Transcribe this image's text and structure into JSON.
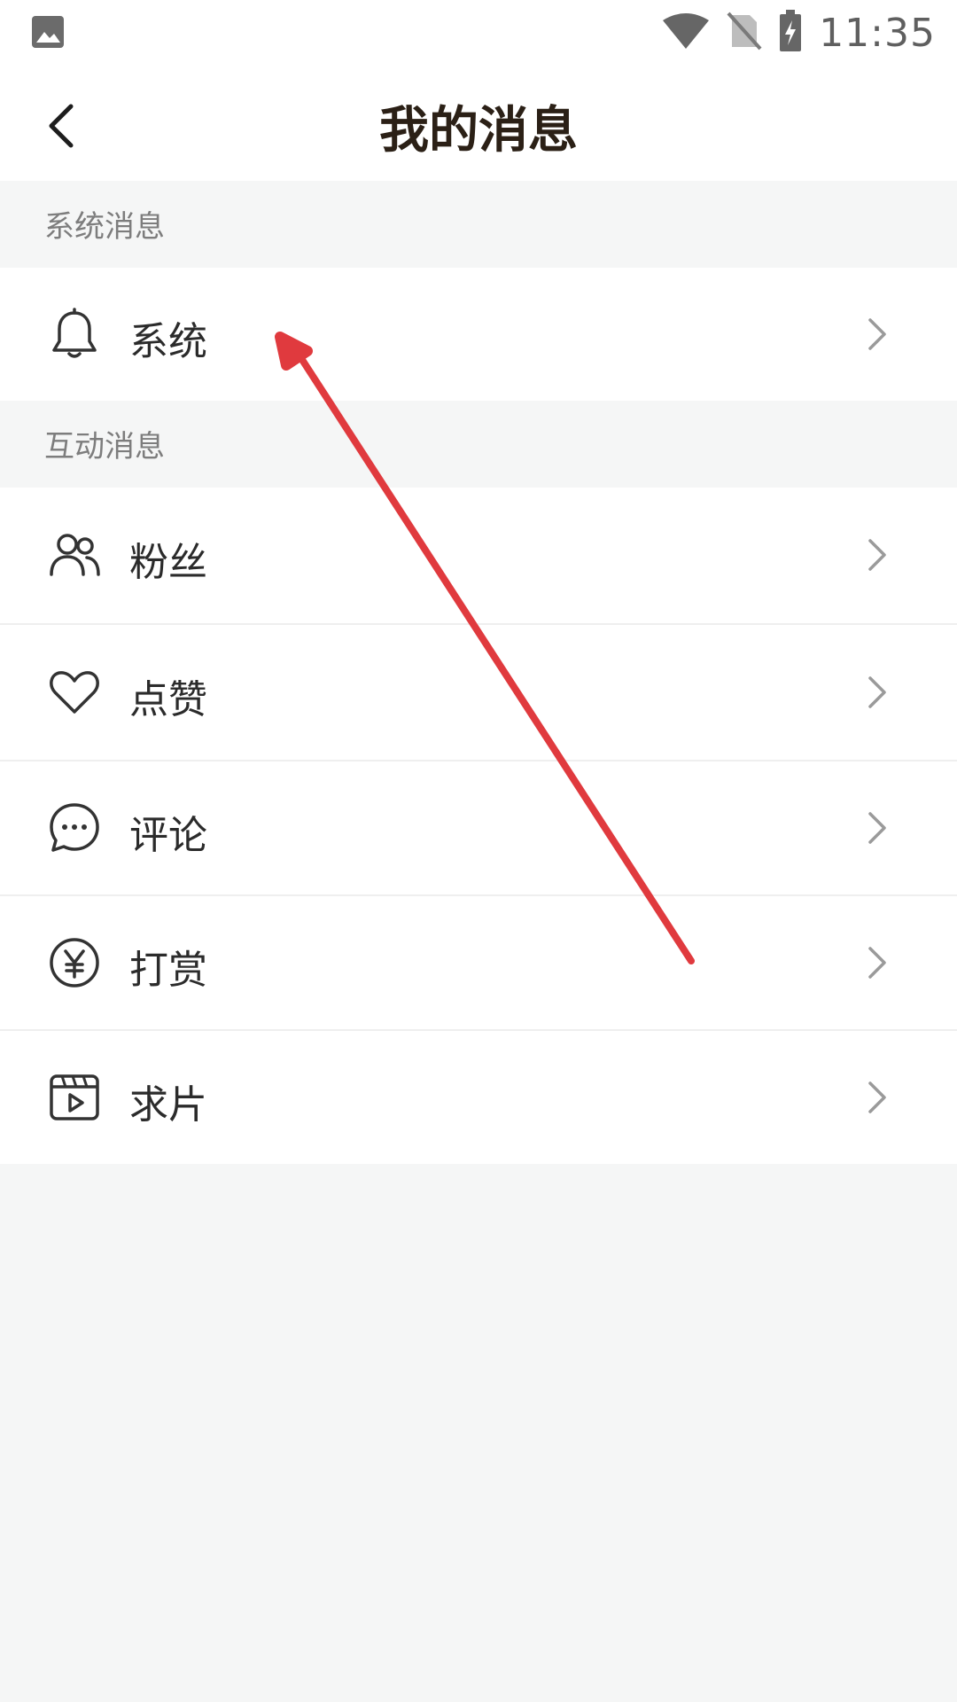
{
  "status_bar": {
    "time": "11:35",
    "icons": [
      "image-icon",
      "wifi-icon",
      "no-sim-icon",
      "battery-charging-icon"
    ]
  },
  "header": {
    "title": "我的消息",
    "back_icon": "chevron-left-icon"
  },
  "sections": [
    {
      "title": "系统消息",
      "items": [
        {
          "label": "系统",
          "icon": "bell-icon"
        }
      ]
    },
    {
      "title": "互动消息",
      "items": [
        {
          "label": "粉丝",
          "icon": "users-icon"
        },
        {
          "label": "点赞",
          "icon": "heart-icon"
        },
        {
          "label": "评论",
          "icon": "chat-bubble-icon"
        },
        {
          "label": "打赏",
          "icon": "yen-coin-icon"
        },
        {
          "label": "求片",
          "icon": "film-icon"
        }
      ]
    }
  ],
  "colors": {
    "background": "#f5f6f6",
    "surface": "#ffffff",
    "title_text": "#2b2016",
    "section_text": "#7d7d7d",
    "annotation_arrow": "#e03a3e"
  }
}
